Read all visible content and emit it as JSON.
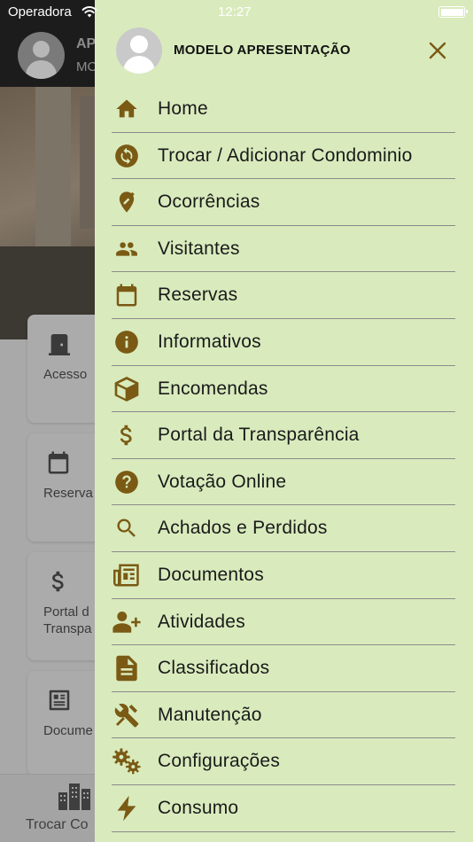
{
  "status_bar": {
    "carrier": "Operadora",
    "time": "12:27"
  },
  "background": {
    "header_name": "AP",
    "header_sub": "MC",
    "cards": [
      {
        "label": "Acesso",
        "icon": "door-icon"
      },
      {
        "label": "Reserva",
        "icon": "calendar-icon"
      },
      {
        "label": "Portal d\nTranspa",
        "icon": "dollar-icon"
      },
      {
        "label": "Docume",
        "icon": "newspaper-icon"
      }
    ],
    "tabbar_label": "Trocar Co",
    "tabbar_icon": "buildings-icon"
  },
  "drawer": {
    "user_name": "MODELO APRESENTAÇÃO",
    "accent_color": "#7a5a14",
    "background_color": "#d9ebbd",
    "items": [
      {
        "label": "Home",
        "icon": "home-icon"
      },
      {
        "label": "Trocar / Adicionar Condominio",
        "icon": "sync-icon"
      },
      {
        "label": "Ocorrências",
        "icon": "location-edit-icon"
      },
      {
        "label": "Visitantes",
        "icon": "people-icon"
      },
      {
        "label": "Reservas",
        "icon": "calendar-icon"
      },
      {
        "label": "Informativos",
        "icon": "info-icon"
      },
      {
        "label": "Encomendas",
        "icon": "box-icon"
      },
      {
        "label": "Portal da Transparência",
        "icon": "dollar-icon"
      },
      {
        "label": "Votação Online",
        "icon": "help-icon"
      },
      {
        "label": "Achados e Perdidos",
        "icon": "search-icon"
      },
      {
        "label": "Documentos",
        "icon": "newspaper-icon"
      },
      {
        "label": "Atividades",
        "icon": "person-add-icon"
      },
      {
        "label": "Classificados",
        "icon": "document-icon"
      },
      {
        "label": "Manutenção",
        "icon": "tools-icon"
      },
      {
        "label": "Configurações",
        "icon": "gears-icon"
      },
      {
        "label": "Consumo",
        "icon": "bolt-icon"
      }
    ]
  }
}
